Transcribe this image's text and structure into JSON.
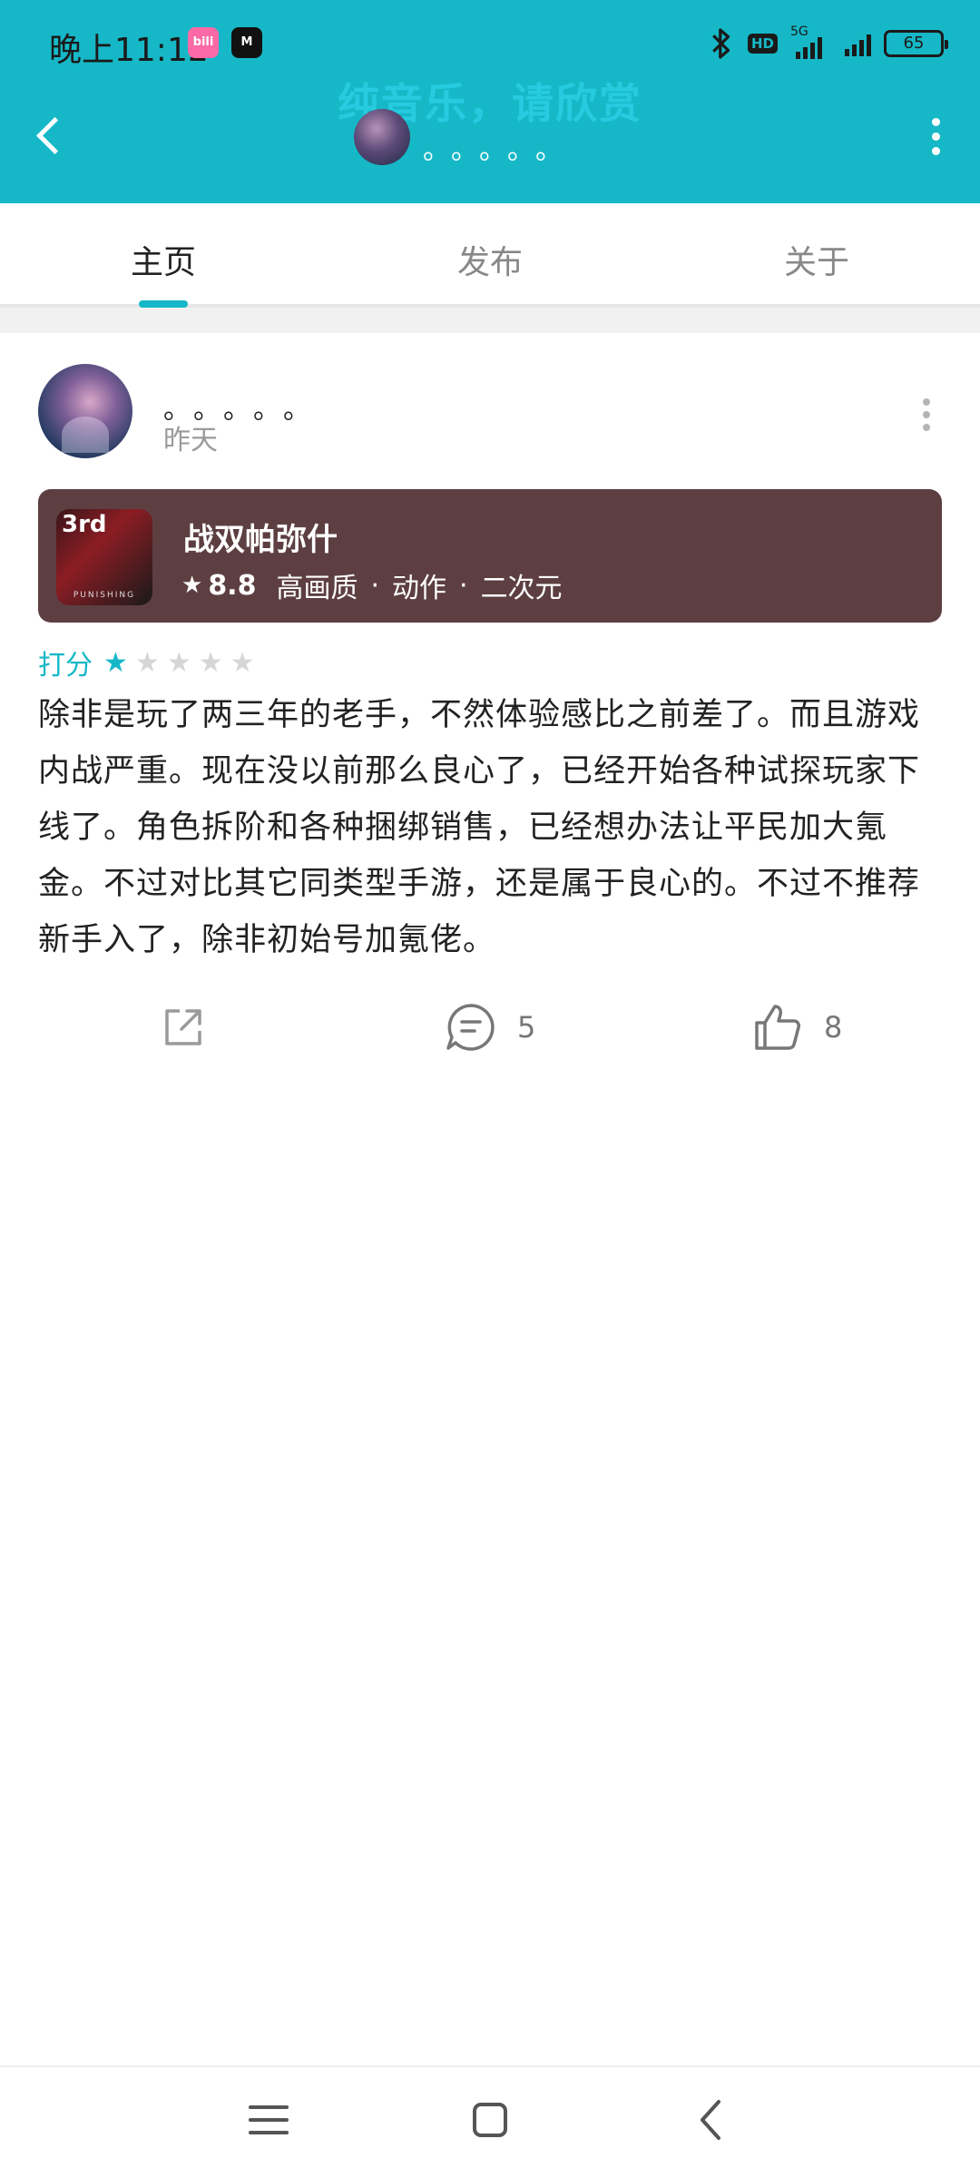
{
  "status_bar": {
    "time": "晚上11:12",
    "notif_app_1": "bili",
    "notif_app_2": "M",
    "hd_label": "HD",
    "network_label": "5G",
    "battery": "65"
  },
  "header": {
    "title": "纯音乐，请欣赏",
    "username": "。。。。。",
    "icons": [
      "back-arrow-icon",
      "more-vertical-icon"
    ]
  },
  "tabs": [
    {
      "label": "主页",
      "active": true
    },
    {
      "label": "发布",
      "active": false
    },
    {
      "label": "关于",
      "active": false
    }
  ],
  "post": {
    "user": "。。。。。",
    "date": "昨天",
    "game": {
      "name": "战双帕弥什",
      "score": "8.8",
      "icon_badge": "3rd",
      "icon_text": "PUNISHING",
      "tags": [
        "高画质",
        "动作",
        "二次元"
      ],
      "card_color": "#5d3f42"
    },
    "rating_label": "打分",
    "rating": 1,
    "rating_max": 5,
    "text": "除非是玩了两三年的老手，不然体验感比之前差了。而且游戏内战严重。现在没以前那么良心了，已经开始各种试探玩家下线了。角色拆阶和各种捆绑销售，已经想办法让平民加大氪金。不过对比其它同类型手游，还是属于良心的。不过不推荐新手入了，除非初始号加氪佬。",
    "comment_count": "5",
    "like_count": "8"
  },
  "colors": {
    "accent": "#16b8c7",
    "header_bg": "#16b8c7",
    "text": "#222222",
    "muted": "#9a9a9a"
  },
  "nav_icons": [
    "menu-icon",
    "home-square-icon",
    "back-triangle-icon"
  ]
}
